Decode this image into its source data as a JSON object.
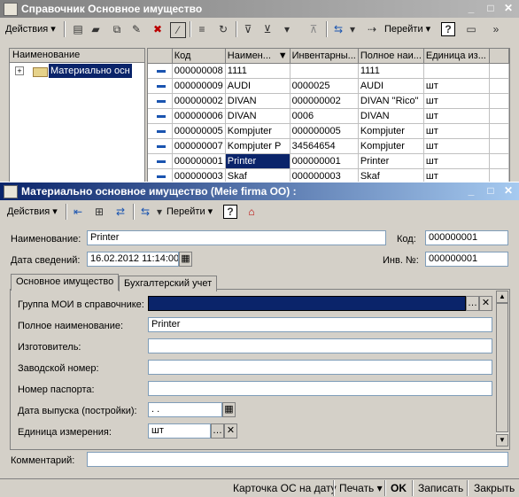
{
  "win1": {
    "title": "Справочник Основное имущество",
    "actions": "Действия",
    "goto": "Перейти",
    "help": "?",
    "tree": {
      "header": "Наименование",
      "item": "Материально осн"
    },
    "columns": [
      "Код",
      "Наимен...",
      "Инвентарны...",
      "Полное наи...",
      "Единица из..."
    ],
    "rows": [
      [
        "000000008",
        "1111",
        "",
        "1111",
        ""
      ],
      [
        "000000009",
        "AUDI",
        "0000025",
        "AUDI",
        "шт"
      ],
      [
        "000000002",
        "DIVAN",
        "000000002",
        "DIVAN \"Rico\"",
        "шт"
      ],
      [
        "000000006",
        "DIVAN",
        "0006",
        "DIVAN",
        "шт"
      ],
      [
        "000000005",
        "Kompjuter",
        "000000005",
        "Kompjuter",
        "шт"
      ],
      [
        "000000007",
        "Kompjuter P",
        "34564654",
        "Kompjuter",
        "шт"
      ],
      [
        "000000001",
        "Printer",
        "000000001",
        "Printer",
        "шт"
      ],
      [
        "000000003",
        "Skaf",
        "000000003",
        "Skaf",
        "шт"
      ]
    ]
  },
  "win2": {
    "title": "Материально основное имущество (Meie firma OO) :",
    "actions": "Действия",
    "goto": "Перейти",
    "help": "?",
    "name_label": "Наименование:",
    "name_value": "Printer",
    "code_label": "Код:",
    "code_value": "000000001",
    "date_label": "Дата сведений:",
    "date_value": "16.02.2012 11:14:00",
    "inv_label": "Инв. №:",
    "inv_value": "000000001",
    "tabs": [
      "Основное имущество",
      "Бухгалтерский учет"
    ],
    "fields": {
      "group_label": "Группа МОИ в справочнике:",
      "group_value": "",
      "fullname_label": "Полное наименование:",
      "fullname_value": "Printer",
      "maker_label": "Изготовитель:",
      "serial_label": "Заводской номер:",
      "passport_label": "Номер паспорта:",
      "release_label": "Дата выпуска (постройки):",
      "release_value": " .  .",
      "unit_label": "Единица измерения:",
      "unit_value": "шт"
    },
    "comment_label": "Комментарий:",
    "status": {
      "card": "Карточка ОС на дату",
      "print": "Печать",
      "ok": "OK",
      "save": "Записать",
      "close": "Закрыть"
    }
  }
}
